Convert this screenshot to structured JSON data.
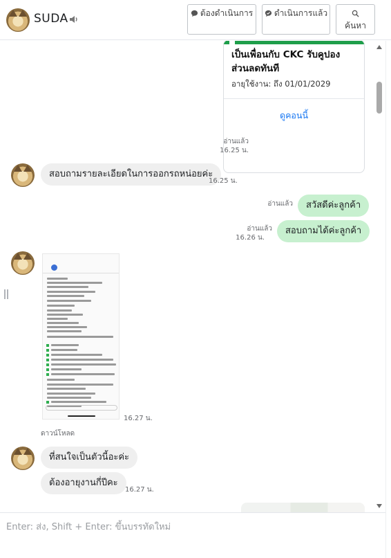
{
  "header": {
    "contact_name": "SUDA",
    "speaker_icon": "speaker-icon",
    "buttons": {
      "pending": "ต้องดำเนินการ",
      "done": "ดำเนินการแล้ว",
      "search": "ค้นหา"
    }
  },
  "chat": {
    "promo_card": {
      "title": "เป็นเพื่อนกับ CKC รับคูปองส่วนลดทันที",
      "validity": "อายุใช้งาน: ถึง 01/01/2029",
      "button": "ดูคอนนี้",
      "read": "อ่านแล้ว",
      "time": "16.25 น."
    },
    "messages": [
      {
        "direction": "in",
        "text": "สอบถามรายละเอียดในการออกรถหน่อยค่ะ",
        "time": "16.25 น."
      },
      {
        "direction": "out",
        "text": "สวัสดีค่ะลูกค้า",
        "read": "อ่านแล้ว"
      },
      {
        "direction": "out",
        "text": "สอบถามได้ค่ะลูกค้า",
        "read": "อ่านแล้ว",
        "time": "16.26 น."
      },
      {
        "direction": "in",
        "type": "image",
        "time": "16.27 น.",
        "download": "ดาวน์โหลด"
      },
      {
        "direction": "in",
        "text": "ที่สนใจเป็นตัวนี้อะค่ะ"
      },
      {
        "direction": "in",
        "text": "ต้องอายุงานกี่ปีคะ",
        "time": "16.27 น."
      }
    ]
  },
  "composer": {
    "placeholder": "Enter: ส่ง, Shift + Enter: ขึ้นบรรทัดใหม่",
    "value": ""
  },
  "colors": {
    "outgoing_bubble": "#c7f0cf",
    "incoming_bubble": "#efefef",
    "link": "#1877f2"
  }
}
